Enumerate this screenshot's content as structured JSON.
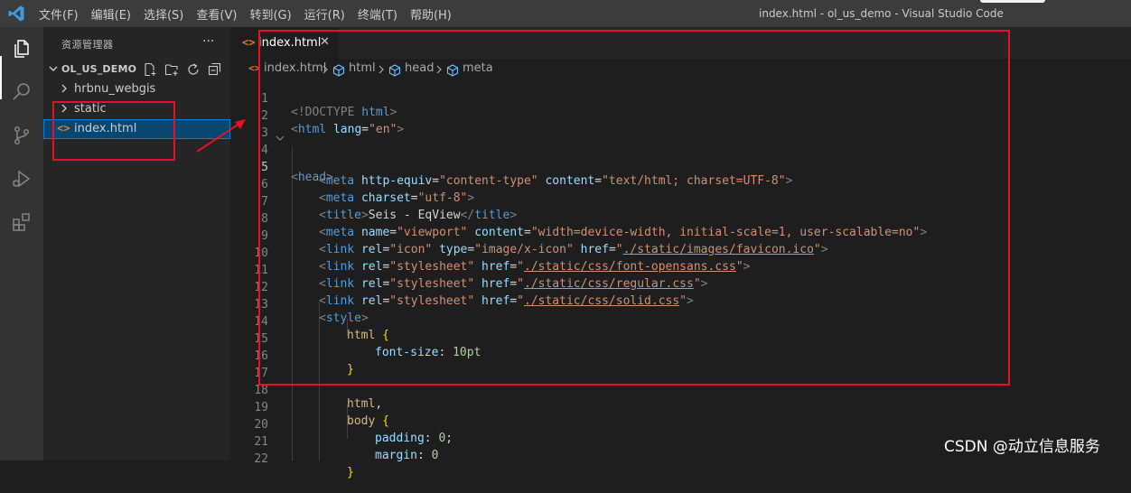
{
  "titlebar": {
    "menus": [
      "文件(F)",
      "编辑(E)",
      "选择(S)",
      "查看(V)",
      "转到(G)",
      "运行(R)",
      "终端(T)",
      "帮助(H)"
    ],
    "window_title": "index.html - ol_us_demo - Visual Studio Code"
  },
  "sidebar": {
    "header": "资源管理器",
    "more": "···",
    "folder": "OL_US_DEMO",
    "items": [
      {
        "label": "hrbnu_webgis",
        "type": "folder"
      },
      {
        "label": "static",
        "type": "folder"
      },
      {
        "label": "index.html",
        "type": "file",
        "selected": true
      }
    ]
  },
  "editor": {
    "tab": {
      "icon": "<>",
      "label": "index.html",
      "close": "✕"
    },
    "breadcrumbs": [
      "index.html",
      "html",
      "head",
      "meta"
    ],
    "line_numbers": [
      "1",
      "2",
      "3",
      "4",
      "5",
      "6",
      "7",
      "8",
      "9",
      "10",
      "11",
      "12",
      "13",
      "14",
      "15",
      "16",
      "17",
      "18",
      "19",
      "20",
      "21",
      "22"
    ],
    "lines": {
      "l1": {
        "a": "<!DOCTYPE",
        "b": " html",
        "c": ">"
      },
      "l2": {
        "a": "<",
        "b": "html",
        "c": " lang",
        "d": "=",
        "e": "\"en\"",
        "f": ">"
      },
      "l4": {
        "a": "<",
        "b": "head",
        "c": ">"
      },
      "l5": {
        "a": "<",
        "b": "meta",
        "c": " http-equiv",
        "d": "=",
        "e": "\"content-type\"",
        "f": " content",
        "g": "=",
        "h": "\"text/html; charset=UTF-8\"",
        "i": ">"
      },
      "l6": {
        "a": "<",
        "b": "meta",
        "c": " charset",
        "d": "=",
        "e": "\"utf-8\"",
        "f": ">"
      },
      "l7": {
        "a": "<",
        "b": "title",
        "c": ">",
        "d": "Seis - EqView",
        "e": "</",
        "f": "title",
        "g": ">"
      },
      "l8": {
        "a": "<",
        "b": "meta",
        "c": " name",
        "d": "=",
        "e": "\"viewport\"",
        "f": " content",
        "g": "=",
        "h": "\"width=device-width, initial-scale=1, user-scalable=no\"",
        "i": ">"
      },
      "l9": {
        "a": "<",
        "b": "link",
        "c": " rel",
        "d": "=",
        "e": "\"icon\"",
        "f": " type",
        "g": "=",
        "h": "\"image/x-icon\"",
        "i": " href",
        "j": "=",
        "k": "\"",
        "l": "./static/images/favicon.ico",
        "m": "\"",
        "n": ">"
      },
      "l10": {
        "a": "<",
        "b": "link",
        "c": " rel",
        "d": "=",
        "e": "\"stylesheet\"",
        "f": " href",
        "g": "=",
        "h": "\"",
        "i": "./static/css/font-opensans.css",
        "j": "\"",
        "k": ">"
      },
      "l11": {
        "a": "<",
        "b": "link",
        "c": " rel",
        "d": "=",
        "e": "\"stylesheet\"",
        "f": " href",
        "g": "=",
        "h": "\"",
        "i": "./static/css/regular.css",
        "j": "\"",
        "k": ">"
      },
      "l12": {
        "a": "<",
        "b": "link",
        "c": " rel",
        "d": "=",
        "e": "\"stylesheet\"",
        "f": " href",
        "g": "=",
        "h": "\"",
        "i": "./static/css/solid.css",
        "j": "\"",
        "k": ">"
      },
      "l13": {
        "a": "<",
        "b": "style",
        "c": ">"
      },
      "l14": {
        "a": "html",
        "b": " {"
      },
      "l15": {
        "a": "font-size",
        "b": ": ",
        "c": "10pt"
      },
      "l16": {
        "a": "}"
      },
      "l18": {
        "a": "html",
        "b": ","
      },
      "l19": {
        "a": "body",
        "b": " {"
      },
      "l20": {
        "a": "padding",
        "b": ": ",
        "c": "0",
        "d": ";"
      },
      "l21": {
        "a": "margin",
        "b": ": ",
        "c": "0"
      },
      "l22": {
        "a": "}"
      }
    }
  },
  "watermark": "CSDN @动立信息服务",
  "colors": {
    "annotation_red": "#e81123",
    "selection_blue": "#094771",
    "html_file_orange": "#e37933"
  }
}
